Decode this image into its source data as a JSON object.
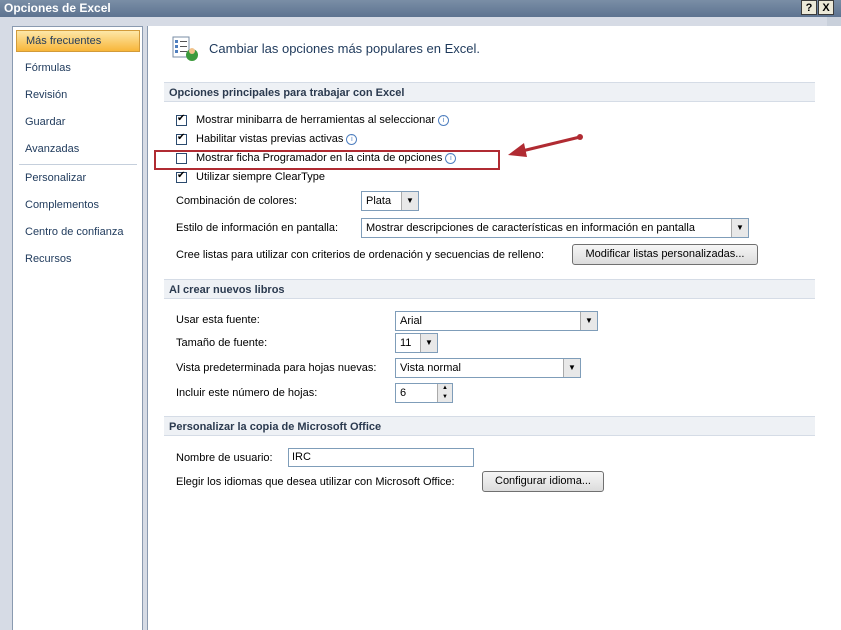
{
  "window": {
    "title": "Opciones de Excel",
    "help_btn": "?",
    "close_btn": "X"
  },
  "sidebar": {
    "items": [
      {
        "label": "Más frecuentes"
      },
      {
        "label": "Fórmulas"
      },
      {
        "label": "Revisión"
      },
      {
        "label": "Guardar"
      },
      {
        "label": "Avanzadas"
      },
      {
        "label": "Personalizar"
      },
      {
        "label": "Complementos"
      },
      {
        "label": "Centro de confianza"
      },
      {
        "label": "Recursos"
      }
    ]
  },
  "header": {
    "title": "Cambiar las opciones más populares en Excel."
  },
  "section1": {
    "title": "Opciones principales para trabajar con Excel",
    "checkboxes": [
      {
        "label": "Mostrar minibarra de herramientas al seleccionar",
        "checked": true
      },
      {
        "label": "Habilitar vistas previas activas",
        "checked": true
      },
      {
        "label": "Mostrar ficha Programador en la cinta de opciones",
        "checked": false
      },
      {
        "label": "Utilizar siempre ClearType",
        "checked": true
      }
    ],
    "color_label": "Combinación de colores:",
    "color_value": "Plata",
    "tooltip_label": "Estilo de información en pantalla:",
    "tooltip_value": "Mostrar descripciones de características en información en pantalla",
    "lists_label": "Cree listas para utilizar con criterios de ordenación y secuencias de relleno:",
    "lists_button": "Modificar listas personalizadas..."
  },
  "section2": {
    "title": "Al crear nuevos libros",
    "font_label": "Usar esta fuente:",
    "font_value": "Arial",
    "size_label": "Tamaño de fuente:",
    "size_value": "11",
    "view_label": "Vista predeterminada para hojas nuevas:",
    "view_value": "Vista normal",
    "sheets_label": "Incluir este número de hojas:",
    "sheets_value": "6"
  },
  "section3": {
    "title": "Personalizar la copia de Microsoft Office",
    "user_label": "Nombre de usuario:",
    "user_value": "IRC",
    "lang_label": "Elegir los idiomas que desea utilizar con Microsoft Office:",
    "lang_button": "Configurar idioma..."
  },
  "icons": {
    "info": "info-icon",
    "arrow": "red-arrow-annotation",
    "header": "options-checklist-icon"
  },
  "colors": {
    "highlight": "#b02b32",
    "active_nav": "#f8b63a"
  }
}
